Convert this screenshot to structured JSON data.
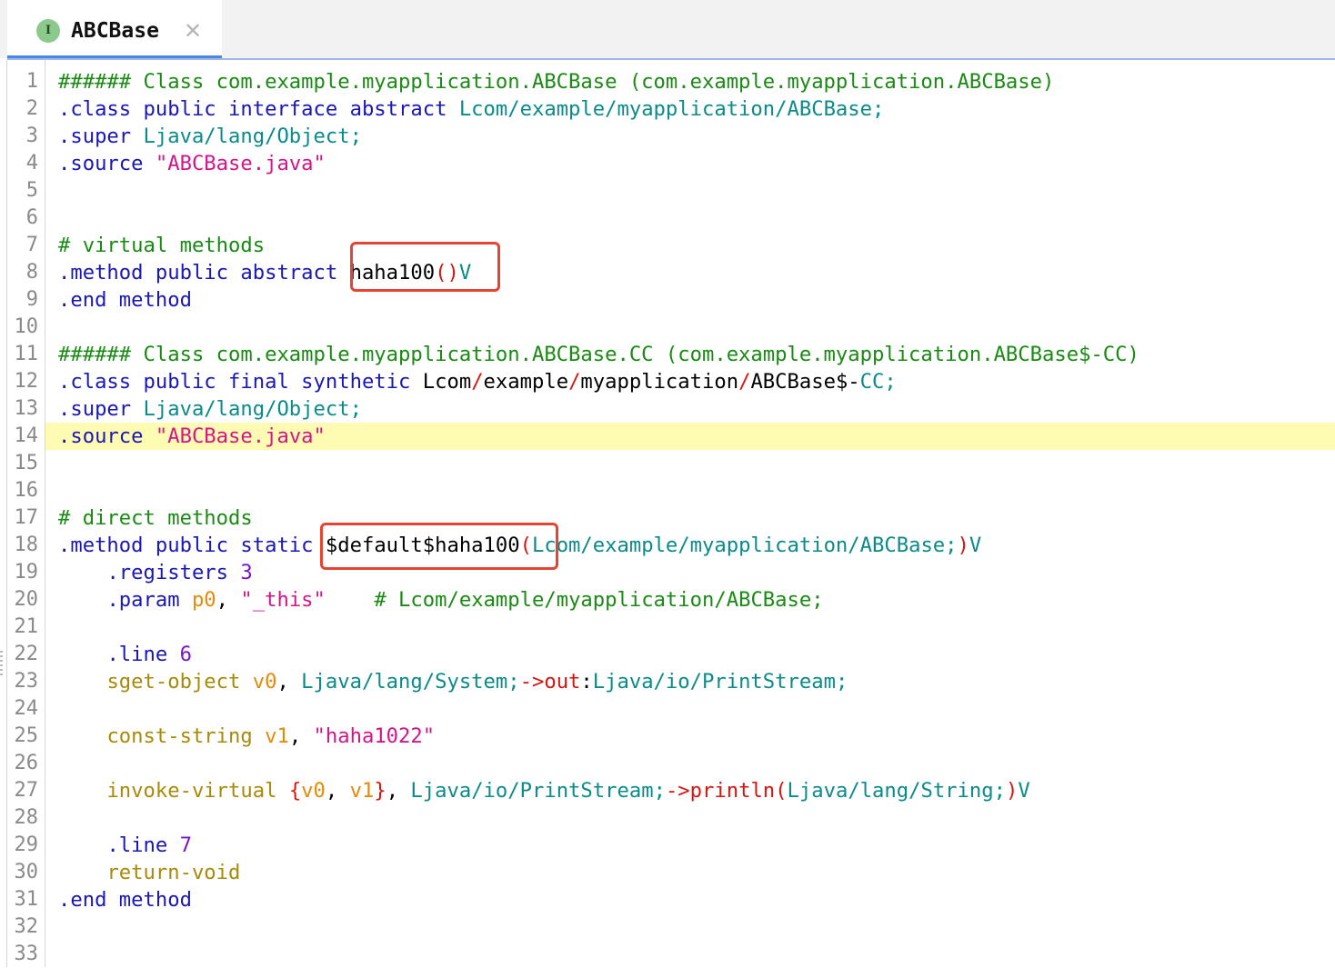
{
  "tab": {
    "icon": {
      "name": "interface-icon",
      "letter": "I",
      "color": "#8cc98c"
    },
    "title": "ABCBase",
    "close_glyph": "✕"
  },
  "colors": {
    "comment": "#1a8a14",
    "keyword": "#1a17b5",
    "type": "#0b8a8a",
    "string": "#d4158a",
    "member": "#d8140e",
    "register": "#e48a0a",
    "opcode": "#a88a0a",
    "number": "#7a14c9",
    "plain": "#000000",
    "current_line_bg": "#fefcb2",
    "annotation_box": "#e64433"
  },
  "current_line": 14,
  "line_numbers": [
    "1",
    "2",
    "3",
    "4",
    "5",
    "6",
    "7",
    "8",
    "9",
    "10",
    "11",
    "12",
    "13",
    "14",
    "15",
    "16",
    "17",
    "18",
    "19",
    "20",
    "21",
    "22",
    "23",
    "24",
    "25",
    "26",
    "27",
    "28",
    "29",
    "30",
    "31",
    "32",
    "33"
  ],
  "lines": [
    [
      [
        "c",
        "###### Class com.example.myapplication.ABCBase (com.example.myapplication.ABCBase)"
      ]
    ],
    [
      [
        "k",
        ".class public interface abstract "
      ],
      [
        "t",
        "Lcom/example/myapplication/ABCBase;"
      ]
    ],
    [
      [
        "k",
        ".super "
      ],
      [
        "t",
        "Ljava/lang/Object;"
      ]
    ],
    [
      [
        "k",
        ".source "
      ],
      [
        "s",
        "\"ABCBase.java\""
      ]
    ],
    [],
    [],
    [
      [
        "c",
        "# virtual methods"
      ]
    ],
    [
      [
        "k",
        ".method public abstract "
      ],
      [
        "p",
        "haha100"
      ],
      [
        "m",
        "()"
      ],
      [
        "t",
        "V"
      ]
    ],
    [
      [
        "k",
        ".end method"
      ]
    ],
    [],
    [
      [
        "c",
        "###### Class com.example.myapplication.ABCBase.CC (com.example.myapplication.ABCBase$-CC)"
      ]
    ],
    [
      [
        "k",
        ".class public final synthetic "
      ],
      [
        "p",
        "Lcom"
      ],
      [
        "m",
        "/"
      ],
      [
        "p",
        "example"
      ],
      [
        "m",
        "/"
      ],
      [
        "p",
        "myapplication"
      ],
      [
        "m",
        "/"
      ],
      [
        "p",
        "ABCBase$-"
      ],
      [
        "t",
        "CC;"
      ]
    ],
    [
      [
        "k",
        ".super "
      ],
      [
        "t",
        "Ljava/lang/Object;"
      ]
    ],
    [
      [
        "k",
        ".source "
      ],
      [
        "s",
        "\"ABCBase.java\""
      ]
    ],
    [],
    [],
    [
      [
        "c",
        "# direct methods"
      ]
    ],
    [
      [
        "k",
        ".method public static "
      ],
      [
        "p",
        "$default$haha100"
      ],
      [
        "m",
        "("
      ],
      [
        "t",
        "Lcom/example/myapplication/ABCBase;"
      ],
      [
        "m",
        ")"
      ],
      [
        "t",
        "V"
      ]
    ],
    [
      [
        "p",
        "    "
      ],
      [
        "k",
        ".registers "
      ],
      [
        "n",
        "3"
      ]
    ],
    [
      [
        "p",
        "    "
      ],
      [
        "k",
        ".param "
      ],
      [
        "r",
        "p0"
      ],
      [
        "p",
        ", "
      ],
      [
        "s",
        "\"_this\""
      ],
      [
        "p",
        "    "
      ],
      [
        "c",
        "# Lcom/example/myapplication/ABCBase;"
      ]
    ],
    [],
    [
      [
        "p",
        "    "
      ],
      [
        "k",
        ".line "
      ],
      [
        "n",
        "6"
      ]
    ],
    [
      [
        "p",
        "    "
      ],
      [
        "o",
        "sget-object "
      ],
      [
        "r",
        "v0"
      ],
      [
        "p",
        ", "
      ],
      [
        "t",
        "Ljava/lang/System;"
      ],
      [
        "m",
        "->out"
      ],
      [
        "p",
        ":"
      ],
      [
        "t",
        "Ljava/io/PrintStream;"
      ]
    ],
    [],
    [
      [
        "p",
        "    "
      ],
      [
        "o",
        "const-string "
      ],
      [
        "r",
        "v1"
      ],
      [
        "p",
        ", "
      ],
      [
        "s",
        "\"haha1022\""
      ]
    ],
    [],
    [
      [
        "p",
        "    "
      ],
      [
        "o",
        "invoke-virtual "
      ],
      [
        "m",
        "{"
      ],
      [
        "r",
        "v0"
      ],
      [
        "p",
        ", "
      ],
      [
        "r",
        "v1"
      ],
      [
        "m",
        "}"
      ],
      [
        "p",
        ", "
      ],
      [
        "t",
        "Ljava/io/PrintStream;"
      ],
      [
        "m",
        "->println("
      ],
      [
        "t",
        "Ljava/lang/String;"
      ],
      [
        "m",
        ")"
      ],
      [
        "t",
        "V"
      ]
    ],
    [],
    [
      [
        "p",
        "    "
      ],
      [
        "k",
        ".line "
      ],
      [
        "n",
        "7"
      ]
    ],
    [
      [
        "p",
        "    "
      ],
      [
        "o",
        "return-void"
      ]
    ],
    [
      [
        "k",
        ".end method"
      ]
    ],
    [],
    []
  ]
}
